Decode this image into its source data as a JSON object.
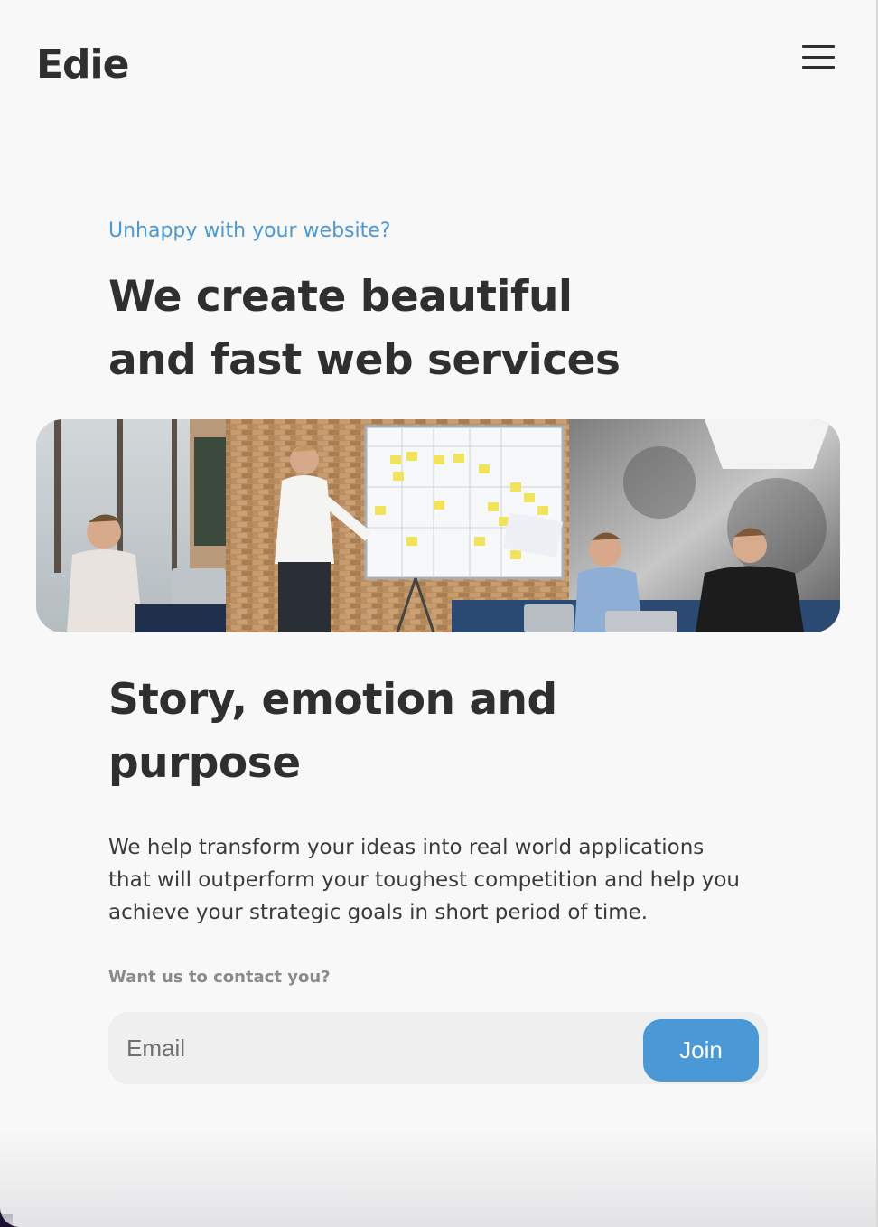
{
  "header": {
    "logo": "Edie",
    "menu_icon": "hamburger-menu-icon"
  },
  "hero": {
    "kicker": "Unhappy with your website?",
    "headline_line1": "We create beautiful",
    "headline_line2": "and fast web services",
    "image_description": "team-meeting-photo"
  },
  "section": {
    "title_line1": "Story, emotion and",
    "title_line2": "purpose",
    "body_line1": "We help transform your ideas into real world applications",
    "body_line2": "that will outperform your toughest competition and help you",
    "body_line3": "achieve your strategic goals in short period of time."
  },
  "contact": {
    "label": "Want us to contact you?",
    "email_placeholder": "Email",
    "email_value": "",
    "join_label": "Join"
  },
  "colors": {
    "accent": "#4a98d6",
    "text": "#2f2f2f",
    "background": "#f8f8f8"
  }
}
